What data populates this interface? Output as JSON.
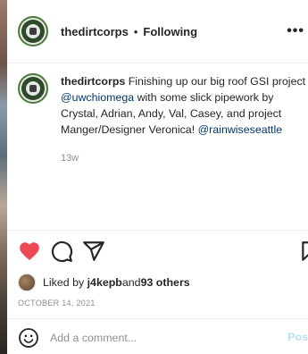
{
  "header": {
    "username": "thedirtcorps",
    "separator": "•",
    "follow_status": "Following",
    "more_icon": "more-horizontal-icon"
  },
  "caption": {
    "username": "thedirtcorps",
    "text_1": " Finishing up our big roof GSI project ",
    "mention_1": "@uwchiomega",
    "text_2": " with some slick pipework by Crystal, Adrian, Andy, Val, Casey, and project Manger/Designer Veronica! ",
    "mention_2": "@rainwiseseattle",
    "time_ago": "13w"
  },
  "actions": {
    "like_icon": "heart-filled-icon",
    "comment_icon": "comment-bubble-icon",
    "share_icon": "paper-plane-icon",
    "save_icon": "bookmark-icon",
    "liked_color": "#ed4956"
  },
  "likes": {
    "prefix": "Liked by ",
    "user": "j4kepb",
    "middle": " and ",
    "others": "93 others"
  },
  "date": "OCTOBER 14, 2021",
  "comment": {
    "placeholder": "Add a comment...",
    "post_label": "Pos"
  }
}
